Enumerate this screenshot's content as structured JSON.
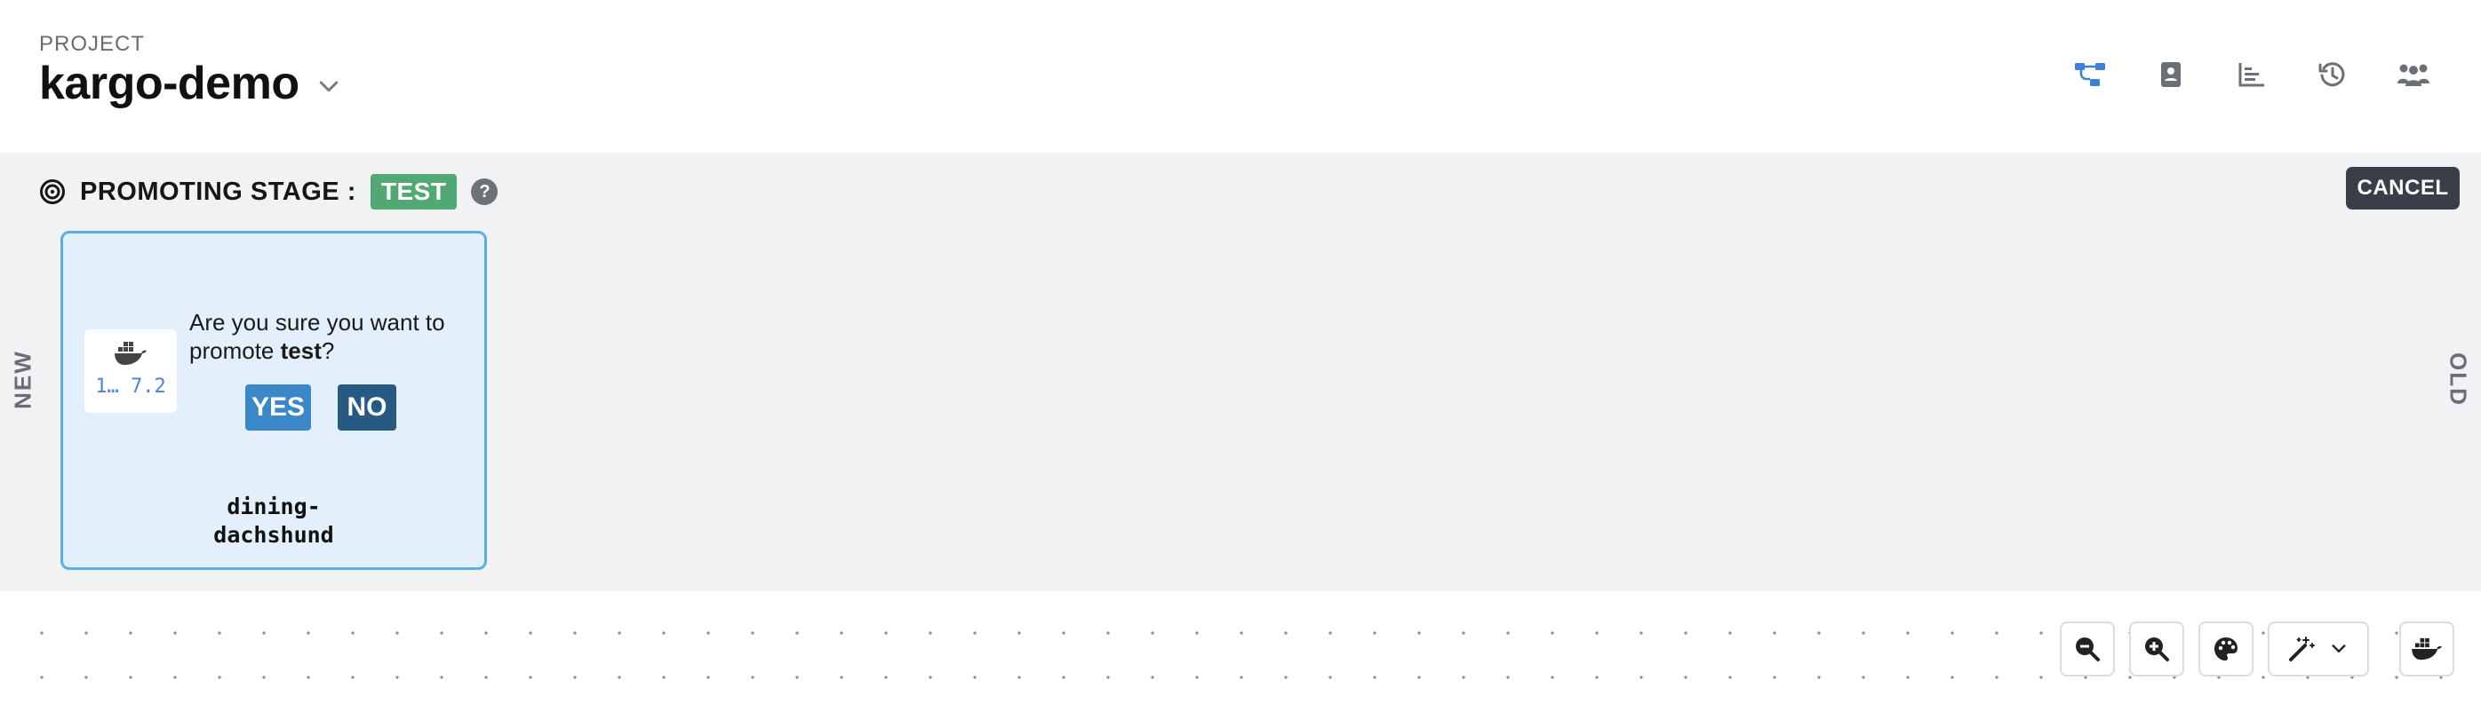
{
  "header": {
    "project_label": "PROJECT",
    "project_name": "kargo-demo",
    "nav_icons": [
      "pipeline-icon",
      "contact-card-icon",
      "bar-chart-icon",
      "history-icon",
      "users-icon"
    ],
    "active_icon_color": "#3b82d6",
    "icon_color": "#6b6f76"
  },
  "promotion": {
    "title": "PROMOTING STAGE :",
    "stage": "TEST",
    "help": "?",
    "cancel": "CANCEL",
    "side_new": "NEW",
    "side_old": "OLD",
    "badge_color": "#52a872"
  },
  "freight": {
    "image_tag": "1… 7.2",
    "question_prefix": "Are you sure you want to promote",
    "question_target": "test",
    "question_suffix": "?",
    "yes": "YES",
    "no": "NO",
    "name": "dining-\ndachshund"
  },
  "canvas_controls": [
    "zoom-out-icon",
    "zoom-in-icon",
    "palette-icon",
    "magic-wand-icon",
    "docker-icon"
  ]
}
